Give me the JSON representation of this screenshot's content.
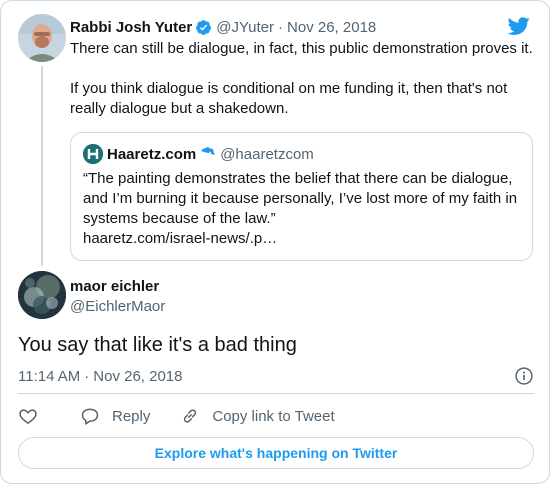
{
  "parent_tweet": {
    "author_name": "Rabbi Josh Yuter",
    "author_handle": "@JYuter",
    "separator": "·",
    "date": "Nov 26, 2018",
    "paragraph_1": "There can still be dialogue, in fact, this public demonstration proves it.",
    "paragraph_2": "If you think dialogue is conditional on me funding it, then that's not really dialogue but a shakedown."
  },
  "quoted_tweet": {
    "author_name": "Haaretz.com",
    "author_handle": "@haaretzcom",
    "text": "“The painting demonstrates the belief that there can be dialogue, and I’m burning it because personally, I’ve lost more of my faith in systems because of the law.”",
    "link": "haaretz.com/israel-news/.p…"
  },
  "reply_tweet": {
    "author_name": "maor eichler",
    "author_handle": "@EichlerMaor",
    "text": "You say that like it's a bad thing",
    "time": "11:14 AM",
    "separator": "·",
    "date": "Nov 26, 2018"
  },
  "actions": {
    "reply_label": "Reply",
    "copy_link_label": "Copy link to Tweet"
  },
  "explore_label": "Explore what's happening on Twitter",
  "icons": {
    "brand": "twitter-bird-icon",
    "verified": "verified-badge-icon",
    "like": "heart-icon",
    "reply": "speech-bubble-icon",
    "copy_link": "link-icon",
    "info": "info-icon"
  },
  "colors": {
    "twitter_blue": "#1d9bf0",
    "text": "#0f1419",
    "muted": "#536471",
    "border": "#cfd9de"
  }
}
